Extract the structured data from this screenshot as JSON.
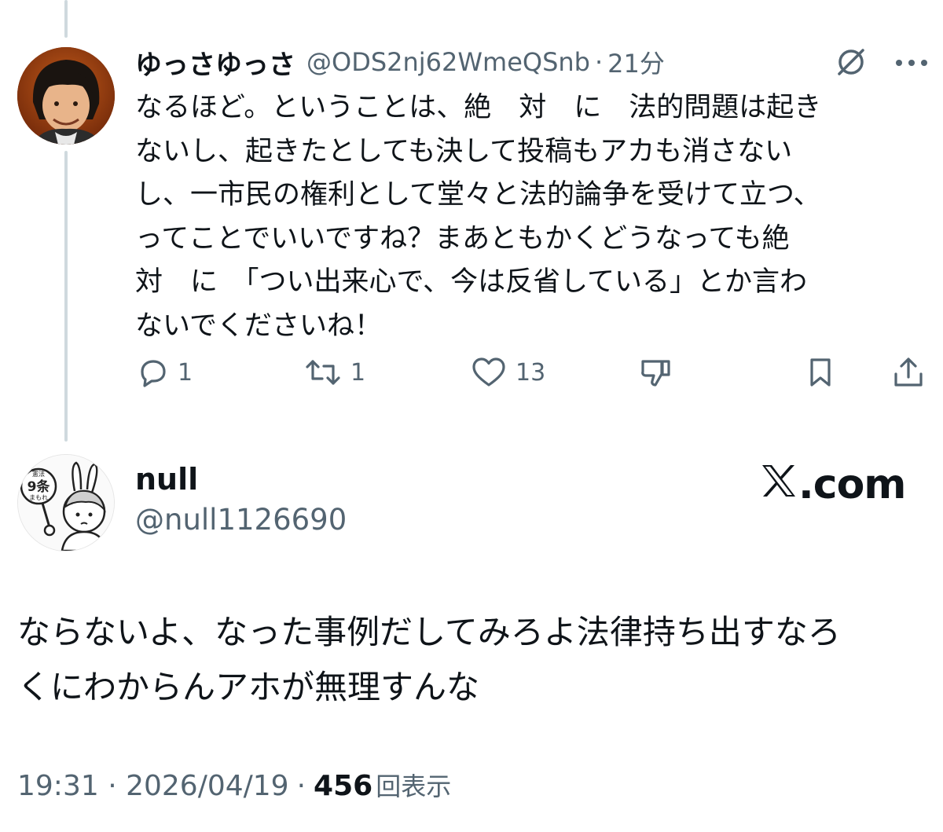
{
  "reply_tweet": {
    "display_name": "ゆっさゆっさ",
    "handle": "@ODS2nj62WmeQSnb",
    "separator": "·",
    "time": "21分",
    "text": "なるほど。ということは、絶　対　に　法的問題は起き\nないし、起きたとしても決して投稿もアカも消さない\nし、一市民の権利として堂々と法的論争を受けて立つ、\nってことでいいですね？まあともかくどうなっても絶\n対　に　「つい出来心で、今は反省している」とか言わ\nないでくださいね！",
    "actions": {
      "reply_count": "1",
      "repost_count": "1",
      "like_count": "13"
    },
    "icons": [
      "grok-icon",
      "more-icon",
      "reply-icon",
      "repost-icon",
      "like-icon",
      "dislike-icon",
      "bookmark-icon",
      "share-icon"
    ]
  },
  "main_tweet": {
    "display_name": "null",
    "handle": "@null1126690",
    "brand": ".com",
    "text": "ならないよ、なった事例だしてみろよ法律持ち出すなろ\nくにわからんアホが無理すんな",
    "timestamp": "19:31 · 2026/04/19",
    "separator": "·",
    "views_count": "456",
    "views_label": "回表示",
    "avatar_badge_text": [
      "憲法",
      "9条",
      "まもれ"
    ]
  },
  "colors": {
    "text": "#0f1419",
    "secondary": "#536471",
    "thread_line": "#cfd9de",
    "background": "#ffffff"
  }
}
